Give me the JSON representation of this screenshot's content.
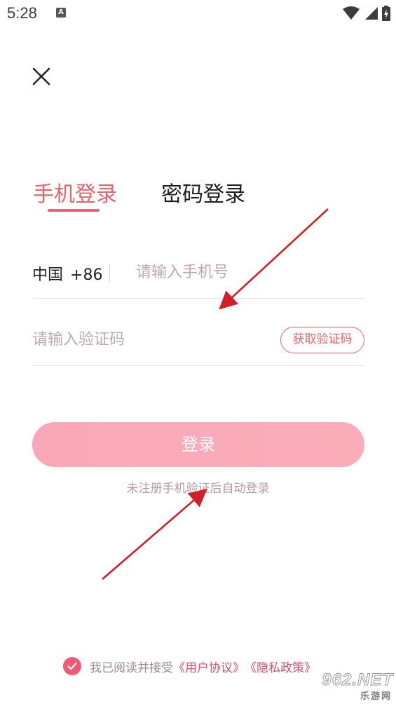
{
  "status_bar": {
    "time": "5:28",
    "notification_letter": "A"
  },
  "tabs": [
    {
      "label": "手机登录",
      "active": true
    },
    {
      "label": "密码登录",
      "active": false
    }
  ],
  "phone": {
    "country": "中国",
    "code": "+86",
    "placeholder": "请输入手机号"
  },
  "verification": {
    "placeholder": "请输入验证码",
    "get_code_label": "获取验证码"
  },
  "login_button": "登录",
  "hint": "未注册手机验证后自动登录",
  "agreement": {
    "checked": true,
    "prefix": "我已阅读并接受",
    "user_agreement": "《用户协议》",
    "privacy_policy": "《隐私政策》"
  },
  "watermark": {
    "brand": "962.NET",
    "sub": "乐游网"
  },
  "colors": {
    "accent": "#e8646d",
    "button": "#f9a3b3",
    "arrow": "#d0202a"
  }
}
